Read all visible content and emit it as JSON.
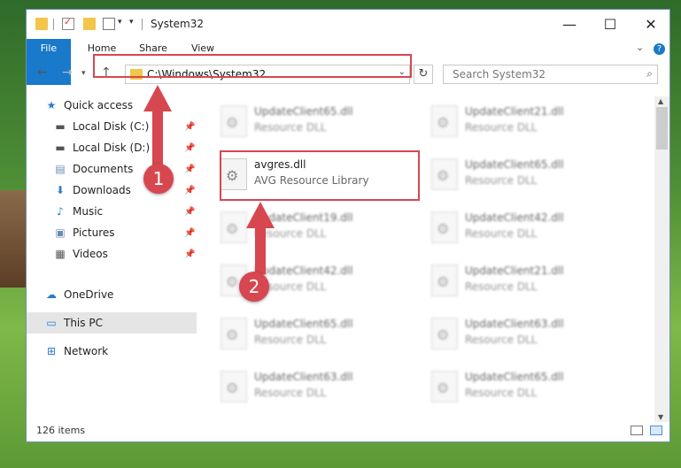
{
  "window": {
    "title": "System32"
  },
  "ribbon": {
    "tabs": [
      "File",
      "Home",
      "Share",
      "View"
    ]
  },
  "address": {
    "path": "C:\\Windows\\System32"
  },
  "search": {
    "placeholder": "Search System32"
  },
  "sidebar": {
    "items": [
      {
        "label": "Quick access",
        "icon": "star-icon"
      },
      {
        "label": "Local Disk (C:)",
        "icon": "drive-icon"
      },
      {
        "label": "Local Disk (D:)",
        "icon": "drive-icon"
      },
      {
        "label": "Documents",
        "icon": "documents-icon"
      },
      {
        "label": "Downloads",
        "icon": "download-icon"
      },
      {
        "label": "Music",
        "icon": "music-icon"
      },
      {
        "label": "Pictures",
        "icon": "pictures-icon"
      },
      {
        "label": "Videos",
        "icon": "videos-icon"
      },
      {
        "label": "OneDrive",
        "icon": "cloud-icon"
      },
      {
        "label": "This PC",
        "icon": "computer-icon"
      },
      {
        "label": "Network",
        "icon": "network-icon"
      }
    ]
  },
  "files": {
    "highlighted": {
      "name": "avgres.dll",
      "desc": "AVG Resource Library"
    },
    "blurred": [
      {
        "name": "UpdateClient65.dll",
        "desc": "Resource DLL"
      },
      {
        "name": "UpdateClient21.dll",
        "desc": "Resource DLL"
      },
      {
        "name": "UpdateClient65.dll",
        "desc": "Resource DLL"
      },
      {
        "name": "UpdateClient19.dll",
        "desc": "Resource DLL"
      },
      {
        "name": "UpdateClient42.dll",
        "desc": "Resource DLL"
      },
      {
        "name": "UpdateClient42.dll",
        "desc": "Resource DLL"
      },
      {
        "name": "UpdateClient21.dll",
        "desc": "Resource DLL"
      },
      {
        "name": "UpdateClient65.dll",
        "desc": "Resource DLL"
      },
      {
        "name": "UpdateClient63.dll",
        "desc": "Resource DLL"
      },
      {
        "name": "UpdateClient63.dll",
        "desc": "Resource DLL"
      },
      {
        "name": "UpdateClient65.dll",
        "desc": "Resource DLL"
      }
    ]
  },
  "status": {
    "count": "126 items"
  },
  "callouts": [
    "1",
    "2"
  ],
  "colors": {
    "accent": "#1979ca",
    "highlight": "#d7474f"
  }
}
